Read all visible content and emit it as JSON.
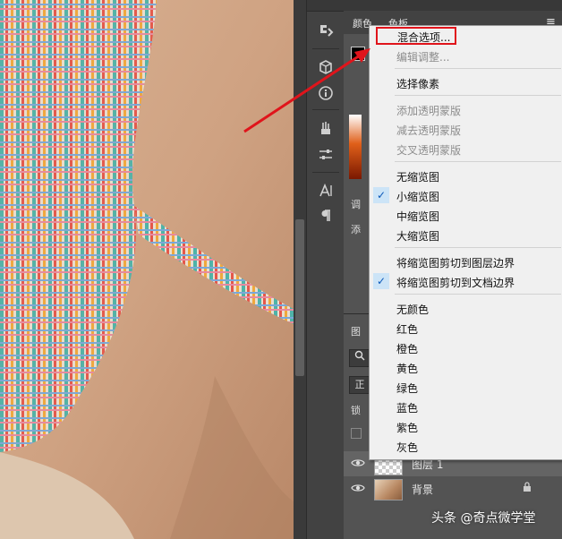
{
  "panel": {
    "tabs": [
      {
        "label": "颜色"
      },
      {
        "label": "色板"
      }
    ],
    "adjust_label": "调",
    "add_label": "添",
    "layers_tab": "图",
    "mode_mini": "正",
    "lock_label": "锁",
    "menu_icon": "≡"
  },
  "toolstrip": {
    "icons": [
      "history-icon",
      "3d-cube-icon",
      "info-icon",
      "brush-icon",
      "properties-sliders-icon",
      "character-icon",
      "paragraph-icon"
    ]
  },
  "menu": {
    "items": [
      {
        "label": "混合选项...",
        "enabled": true,
        "checked": false
      },
      {
        "label": "编辑调整...",
        "enabled": false,
        "checked": false
      },
      {
        "label": "选择像素",
        "enabled": true,
        "checked": false
      },
      {
        "label": "添加透明蒙版",
        "enabled": false,
        "checked": false
      },
      {
        "label": "减去透明蒙版",
        "enabled": false,
        "checked": false
      },
      {
        "label": "交叉透明蒙版",
        "enabled": false,
        "checked": false
      },
      {
        "label": "无缩览图",
        "enabled": true,
        "checked": false
      },
      {
        "label": "小缩览图",
        "enabled": true,
        "checked": true
      },
      {
        "label": "中缩览图",
        "enabled": true,
        "checked": false
      },
      {
        "label": "大缩览图",
        "enabled": true,
        "checked": false
      },
      {
        "label": "将缩览图剪切到图层边界",
        "enabled": true,
        "checked": false
      },
      {
        "label": "将缩览图剪切到文档边界",
        "enabled": true,
        "checked": true
      },
      {
        "label": "无颜色",
        "enabled": true,
        "checked": false
      },
      {
        "label": "红色",
        "enabled": true,
        "checked": false
      },
      {
        "label": "橙色",
        "enabled": true,
        "checked": false
      },
      {
        "label": "黄色",
        "enabled": true,
        "checked": false
      },
      {
        "label": "绿色",
        "enabled": true,
        "checked": false
      },
      {
        "label": "蓝色",
        "enabled": true,
        "checked": false
      },
      {
        "label": "紫色",
        "enabled": true,
        "checked": false
      },
      {
        "label": "灰色",
        "enabled": true,
        "checked": false
      }
    ]
  },
  "layers": [
    {
      "name": "图层 1",
      "locked": false,
      "selected": true
    },
    {
      "name": "背景",
      "locked": true,
      "selected": false
    }
  ],
  "watermark": "头条 @奇点微学堂",
  "colors": {
    "highlight": "#e0141b",
    "check_bg": "#cce4f7",
    "panel_bg": "#535353",
    "menu_bg": "#f0f0f0"
  }
}
